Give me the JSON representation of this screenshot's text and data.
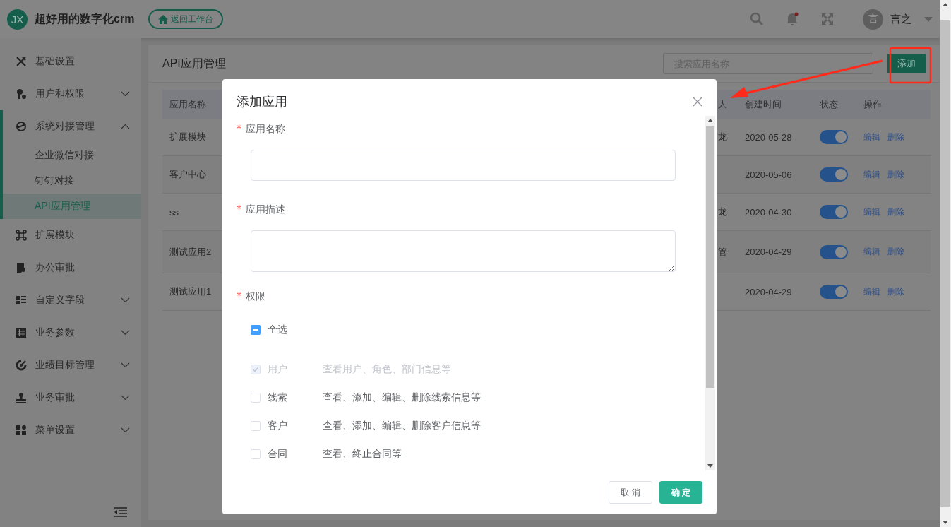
{
  "header": {
    "logo_text": "JX",
    "title": "超好用的数字化crm",
    "back_button": "返回工作台",
    "notification_dot": true,
    "user": {
      "avatar_text": "言",
      "name": "言之"
    }
  },
  "sidebar": {
    "items": [
      {
        "label": "基础设置"
      },
      {
        "label": "用户和权限",
        "expanded": false
      },
      {
        "label": "系统对接管理",
        "expanded": true,
        "children": [
          {
            "label": "企业微信对接",
            "selected": false
          },
          {
            "label": "钉钉对接",
            "selected": false
          },
          {
            "label": "API应用管理",
            "selected": true
          }
        ]
      },
      {
        "label": "扩展模块"
      },
      {
        "label": "办公审批"
      },
      {
        "label": "自定义字段",
        "expanded": false
      },
      {
        "label": "业务参数",
        "expanded": false
      },
      {
        "label": "业绩目标管理",
        "expanded": false
      },
      {
        "label": "业务审批",
        "expanded": false
      },
      {
        "label": "菜单设置",
        "expanded": false
      }
    ]
  },
  "page": {
    "title": "API应用管理",
    "search": {
      "placeholder": "搜索应用名称"
    },
    "add_button": "添加"
  },
  "table": {
    "columns": [
      "应用名称",
      "人",
      "创建时间",
      "状态",
      "操作"
    ],
    "rows": [
      {
        "name": "扩展模块",
        "column_3": "龙",
        "created": "2020-05-28",
        "on": true,
        "actions": [
          "编辑",
          "删除"
        ]
      },
      {
        "name": "客户中心",
        "created": "2020-05-06",
        "on": true,
        "actions": [
          "编辑",
          "删除"
        ]
      },
      {
        "name": "ss",
        "column_3": "龙",
        "created": "2020-04-30",
        "on": true,
        "actions": [
          "编辑",
          "删除"
        ]
      },
      {
        "name": "测试应用2",
        "column_3": "管",
        "created": "2020-04-29",
        "on": true,
        "actions": [
          "编辑",
          "删除"
        ]
      },
      {
        "name": "测试应用1",
        "created": "2020-04-29",
        "on": true,
        "actions": [
          "编辑",
          "删除"
        ]
      }
    ]
  },
  "dialog": {
    "title": "添加应用",
    "fields": [
      {
        "label": "应用名称",
        "required": true,
        "kind": "input"
      },
      {
        "label": "应用描述",
        "required": true,
        "kind": "textarea"
      }
    ],
    "permissions": {
      "label": "权限",
      "required": true,
      "select_all": {
        "label": "全选",
        "indeterminate": true
      },
      "items": [
        {
          "label": "用户",
          "description": "查看用户、角色、部门信息等",
          "checked": true,
          "disabled": true
        },
        {
          "label": "线索",
          "description": "查看、添加、编辑、删除线索信息等",
          "checked": false,
          "disabled": false
        },
        {
          "label": "客户",
          "description": "查看、添加、编辑、删除客户信息等",
          "checked": false,
          "disabled": false
        },
        {
          "label": "合同",
          "description": "查看、终止合同等",
          "checked": false,
          "disabled": false
        }
      ]
    },
    "buttons": {
      "cancel": "取 消",
      "confirm": "确 定"
    }
  }
}
